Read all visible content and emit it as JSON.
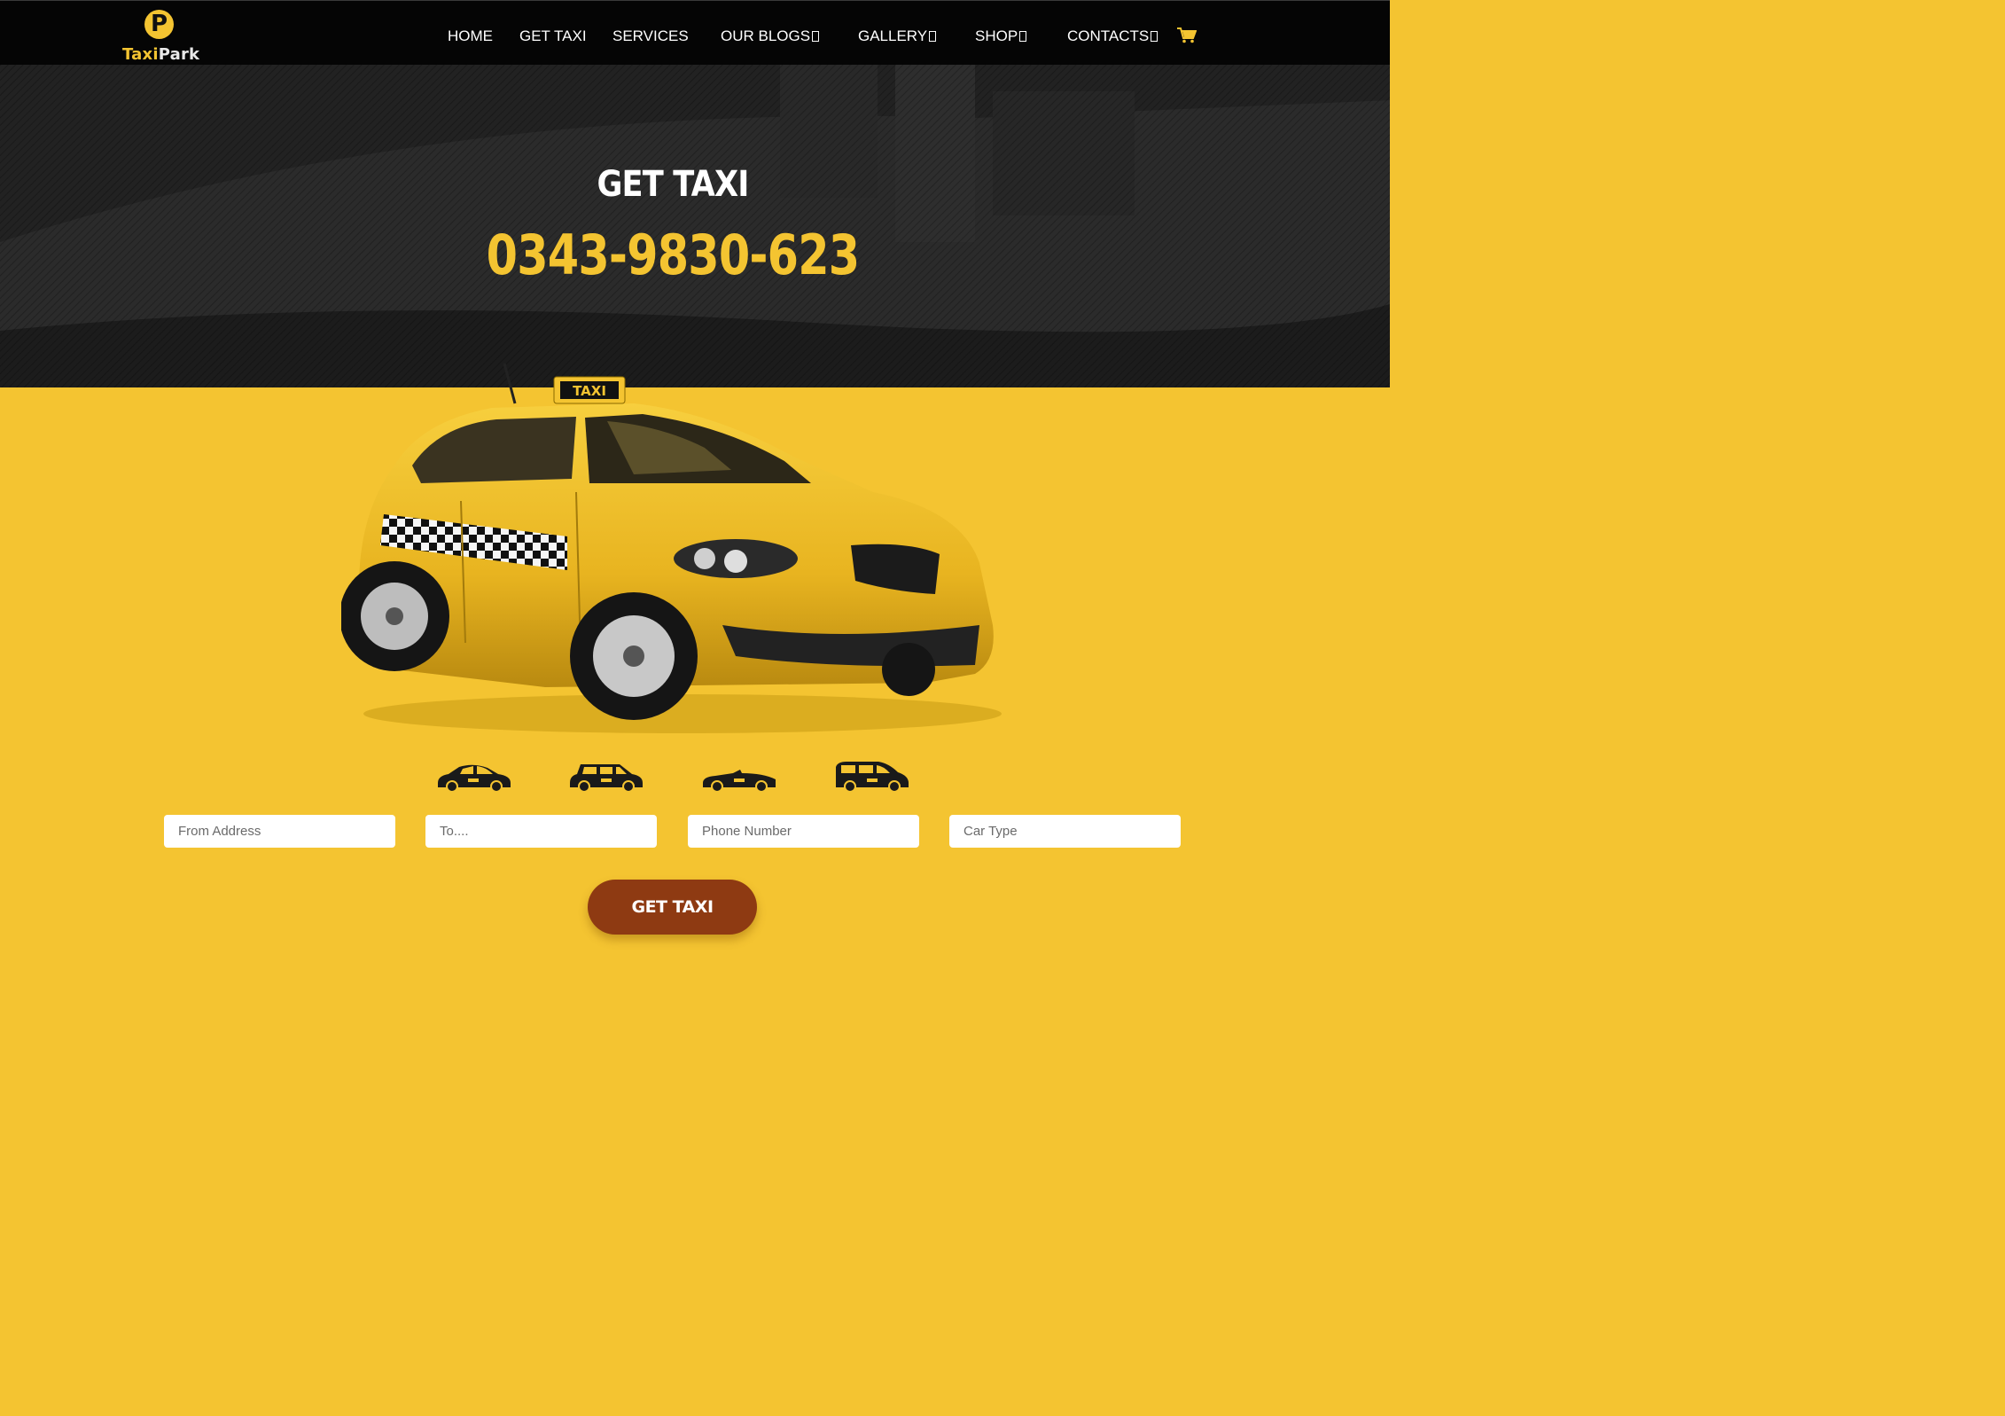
{
  "brand": {
    "logo_letter": "P",
    "name_part1": "Taxi",
    "name_part2": "Park"
  },
  "nav": {
    "items": [
      {
        "label": "HOME",
        "has_dropdown": false
      },
      {
        "label": "GET TAXI",
        "has_dropdown": false
      },
      {
        "label": "SERVICES",
        "has_dropdown": false
      },
      {
        "label": "OUR BLOGS",
        "has_dropdown": true
      },
      {
        "label": "GALLERY",
        "has_dropdown": true
      },
      {
        "label": "SHOP",
        "has_dropdown": true
      },
      {
        "label": "CONTACTS",
        "has_dropdown": true
      }
    ],
    "cart_icon": "cart-icon"
  },
  "hero": {
    "title": "GET TAXI",
    "phone": "0343-9830-623"
  },
  "car_image": {
    "roof_sign": "TAXI"
  },
  "car_types": [
    "sedan-icon",
    "wagon-icon",
    "convertible-icon",
    "minivan-icon"
  ],
  "form": {
    "from_placeholder": "From Address",
    "to_placeholder": "To....",
    "phone_placeholder": "Phone Number",
    "car_type_placeholder": "Car Type",
    "submit_label": "GET TAXI"
  },
  "colors": {
    "accent": "#f4c431",
    "nav_bg": "#050505",
    "button": "#8e3a12"
  }
}
